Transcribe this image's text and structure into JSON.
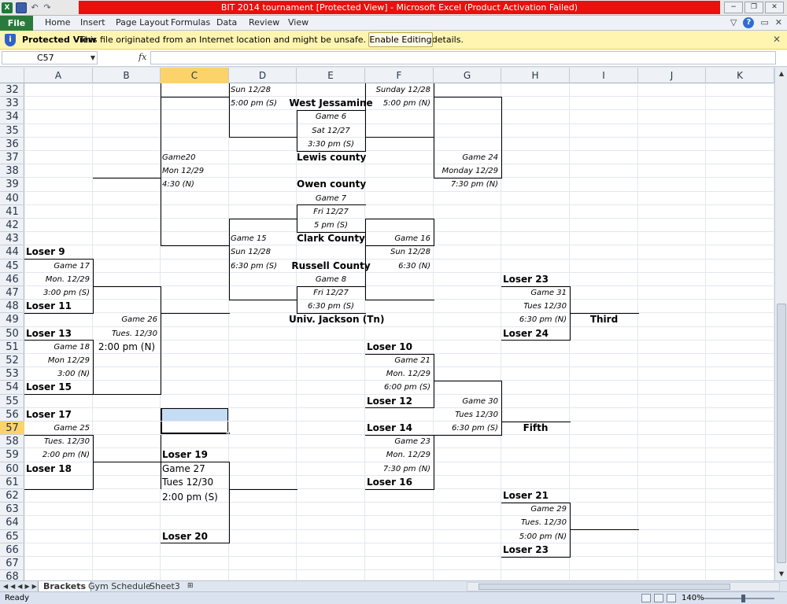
{
  "window": {
    "title": "BIT 2014 tournament  [Protected View]  -  Microsoft Excel (Product Activation Failed)",
    "minimize": "−",
    "restore": "❐",
    "close": "✕"
  },
  "ribbon": {
    "file": "File",
    "tabs": [
      "Home",
      "Insert",
      "Page Layout",
      "Formulas",
      "Data",
      "Review",
      "View"
    ]
  },
  "protected_view": {
    "title": "Protected View",
    "message": "This file originated from an Internet location and might be unsafe. Click for more details.",
    "button": "Enable Editing"
  },
  "formula_bar": {
    "name_box": "C57",
    "fx": "fx",
    "value": ""
  },
  "columns": [
    "A",
    "B",
    "C",
    "D",
    "E",
    "F",
    "G",
    "H",
    "I",
    "J",
    "K"
  ],
  "selected_column": "C",
  "rows": [
    "32",
    "33",
    "34",
    "35",
    "36",
    "37",
    "38",
    "39",
    "40",
    "41",
    "42",
    "43",
    "44",
    "45",
    "46",
    "47",
    "48",
    "49",
    "50",
    "51",
    "52",
    "53",
    "54",
    "55",
    "56",
    "57",
    "58",
    "59",
    "60",
    "61",
    "62",
    "63",
    "64",
    "65",
    "66",
    "67",
    "68"
  ],
  "selected_row": "57",
  "cells": {
    "d32": "Sun 12/28",
    "f32": "Sunday 12/28",
    "d33": "5:00 pm (S)",
    "e33": "West Jessamine",
    "f33": "5:00 pm (N)",
    "e34": "Game 6",
    "e35": "Sat 12/27",
    "e36": "3:30 pm (S)",
    "c37": "Game20",
    "e37": "Lewis county",
    "g37": "Game 24",
    "c38": "Mon 12/29",
    "g38": "Monday 12/29",
    "c39": "4:30 (N)",
    "e39": "Owen county",
    "g39": "7:30 pm (N)",
    "e40": "Game 7",
    "e41": "Fri 12/27",
    "e42": "5 pm (S)",
    "d43": "Game 15",
    "e43": "Clark County",
    "f43": "Game 16",
    "a44": "Loser 9",
    "d44": "Sun 12/28",
    "f44": "Sun 12/28",
    "a45": "Game 17",
    "d45": "6:30 pm (S)",
    "e45": "Russell County",
    "f45": "6:30 (N)",
    "a46": "Mon. 12/29",
    "e46": "Game 8",
    "h46": "Loser 23",
    "a47": "3:00 pm (S)",
    "e47": "Fri 12/27",
    "h47": "Game 31",
    "a48": "Loser 11",
    "e48": "6:30 pm (S)",
    "h48": "Tues 12/30",
    "b49": "Game 26",
    "e49": "Univ. Jackson (Tn)",
    "h49": "6:30 pm (N)",
    "i49": "Third",
    "a50": "Loser 13",
    "b50": "Tues. 12/30",
    "h50": "Loser 24",
    "a51": "Game 18",
    "b51": "2:00 pm (N)",
    "f51": "Loser 10",
    "a52": "Mon 12/29",
    "f52": "Game 21",
    "a53": "3:00 (N)",
    "f53": "Mon. 12/29",
    "a54": "Loser 15",
    "f54": "6:00 pm (S)",
    "f55": "Loser 12",
    "g55": "Game 30",
    "a56": "Loser 17",
    "g56": "Tues 12/30",
    "a57": "Game 25",
    "f57": "Loser 14",
    "g57": "6:30 pm (S)",
    "h57": "Fifth",
    "a58": "Tues. 12/30",
    "f58": "Game 23",
    "a59": "2:00 pm (N)",
    "c59": "Loser 19",
    "f59": "Mon. 12/29",
    "a60": "Loser 18",
    "c60": "Game 27",
    "f60": "7:30 pm (N)",
    "c61": "Tues 12/30",
    "f61": "Loser 16",
    "c62": "2:00 pm (S)",
    "h62": "Loser 21",
    "h63": "Game 29",
    "h64": "Tues. 12/30",
    "c65": "Loser 20",
    "h65": "5:00 pm (N)",
    "h66": "Loser 23"
  },
  "sheets": [
    "Brackets",
    "Gym Schedule",
    "Sheet3"
  ],
  "active_sheet": "Brackets",
  "status": {
    "ready": "Ready",
    "zoom": "140%"
  }
}
